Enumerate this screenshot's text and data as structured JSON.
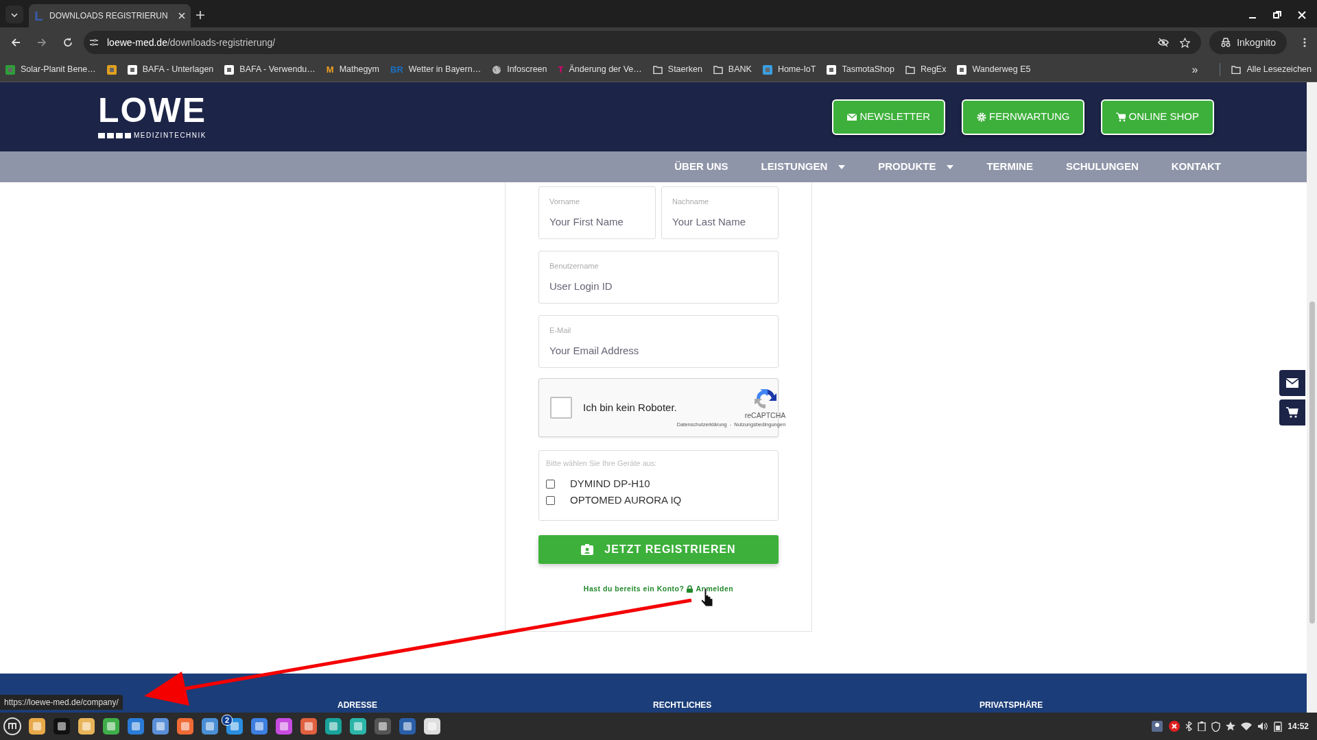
{
  "browser": {
    "tabs": [
      {
        "title": "DOWNLOADS REGISTRIERUN",
        "selected": true
      }
    ],
    "url": {
      "host": "loewe-med.de",
      "path": "/downloads-registrierung/"
    },
    "profile": "Inkognito",
    "bookmarks": [
      {
        "label": "Solar-Planit Bene…",
        "kind": "site",
        "color": "#2e9e3a"
      },
      {
        "kind": "site",
        "color": "#e0a020"
      },
      {
        "label": "BAFA - Unterlagen",
        "kind": "site",
        "color": "#ffffff"
      },
      {
        "label": "BAFA - Verwendu…",
        "kind": "site",
        "color": "#ffffff"
      },
      {
        "label": "Mathegym",
        "kind": "letter",
        "mark": "M",
        "color": "#f0a020"
      },
      {
        "label": "Wetter in Bayern…",
        "kind": "letter",
        "mark": "BR",
        "color": "#1a6fc4"
      },
      {
        "label": "Infoscreen",
        "kind": "globe",
        "color": "#bbbbbb"
      },
      {
        "label": "Änderung der Ve…",
        "kind": "letter",
        "mark": "T",
        "color": "#e20074"
      },
      {
        "label": "Staerken",
        "kind": "folder",
        "color": "#dddddd"
      },
      {
        "label": "BANK",
        "kind": "folder",
        "color": "#dddddd"
      },
      {
        "label": "Home-IoT",
        "kind": "site",
        "color": "#3a9ee0"
      },
      {
        "label": "TasmotaShop",
        "kind": "site",
        "color": "#ffffff"
      },
      {
        "label": "RegEx",
        "kind": "folder",
        "color": "#dddddd"
      },
      {
        "label": "Wanderweg E5",
        "kind": "site",
        "color": "#ffffff"
      }
    ],
    "more": "»",
    "all_bookmarks": "Alle Lesezeichen"
  },
  "site": {
    "logo": {
      "word": "LOWE",
      "tagline": "MEDIZINTECHNIK"
    },
    "header_buttons": [
      {
        "label": "NEWSLETTER",
        "kind": "mail"
      },
      {
        "label": "FERNWARTUNG",
        "kind": "gear"
      },
      {
        "label": "ONLINE SHOP",
        "kind": "cart"
      }
    ],
    "nav": [
      {
        "label": "ÜBER UNS",
        "dropdown": false
      },
      {
        "label": "LEISTUNGEN",
        "dropdown": true
      },
      {
        "label": "PRODUKTE",
        "dropdown": true
      },
      {
        "label": "TERMINE",
        "dropdown": false
      },
      {
        "label": "SCHULUNGEN",
        "dropdown": false
      },
      {
        "label": "KONTAKT",
        "dropdown": false
      }
    ],
    "form": {
      "rows": [
        [
          {
            "label": "Vorname",
            "placeholder": "Your First Name"
          },
          {
            "label": "Nachname",
            "placeholder": "Your Last Name"
          }
        ],
        [
          {
            "label": "Benutzername",
            "placeholder": "User Login ID"
          }
        ],
        [
          {
            "label": "E-Mail",
            "placeholder": "Your Email Address"
          }
        ]
      ],
      "captcha": {
        "label": "Ich bin kein Roboter.",
        "checked": false,
        "brand": "reCAPTCHA",
        "privacy": "Datenschutzerklärung",
        "separator": "-",
        "terms": "Nutzungsbedingungen"
      },
      "devices": {
        "label": "Bitte wählen Sie Ihre Geräte aus:",
        "options": [
          {
            "label": "DYMIND DP-H10",
            "checked": false
          },
          {
            "label": "OPTOMED AURORA IQ",
            "checked": false
          }
        ]
      },
      "submit": "JETZT REGISTRIEREN",
      "login_prompt": "Hast du bereits ein Konto?",
      "login_link": "Anmelden"
    },
    "footer": {
      "headings": [
        "ADRESSE",
        "RECHTLICHES",
        "PRIVATSPHÄRE"
      ]
    }
  },
  "status_url": "https://loewe-med.de/company/",
  "taskbar": {
    "badge": "2",
    "clock": "14:52"
  }
}
